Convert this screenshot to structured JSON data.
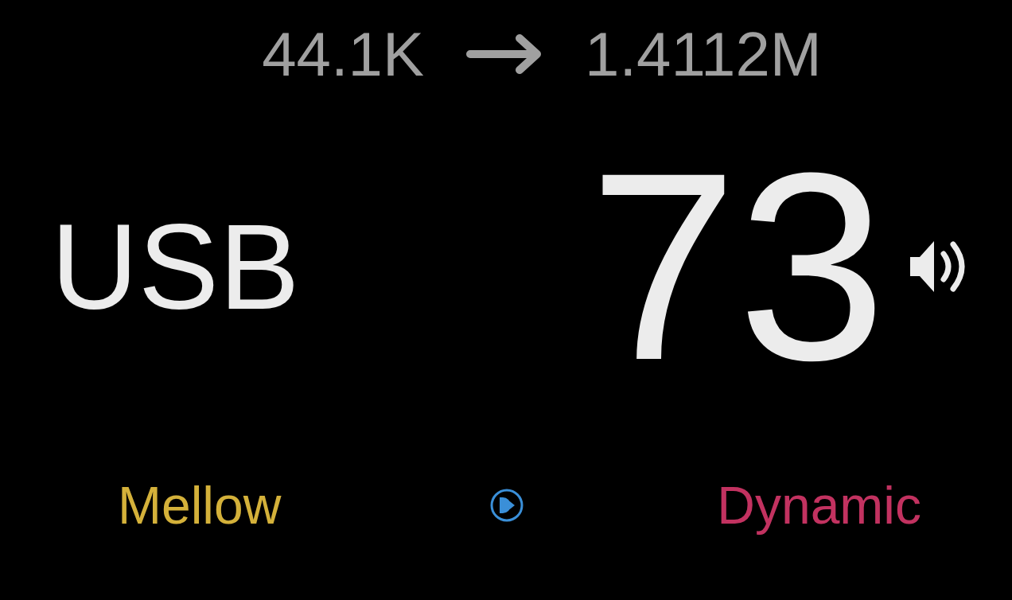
{
  "rate": {
    "input": "44.1K",
    "output": "1.4112M"
  },
  "source": "USB",
  "volume": "73",
  "modes": [
    {
      "label": "Mellow",
      "color": "#d4b13a"
    },
    {
      "label": "Dynamic",
      "color": "#c23260"
    }
  ]
}
